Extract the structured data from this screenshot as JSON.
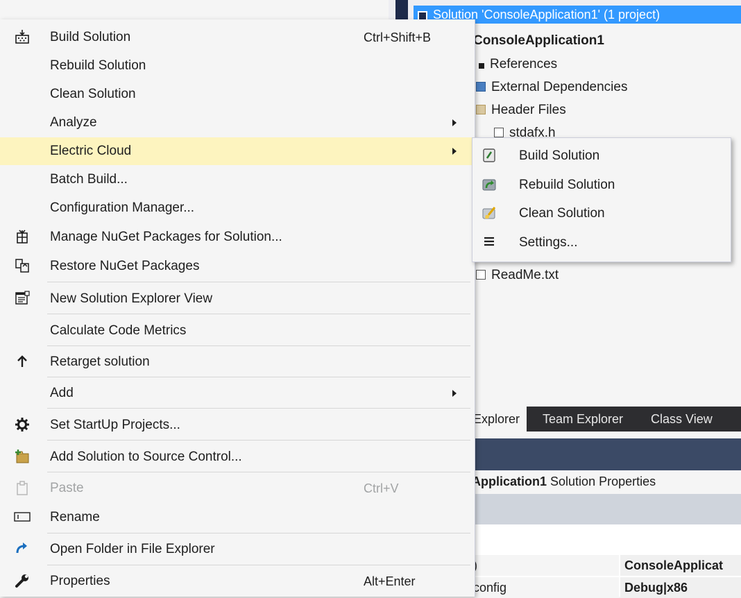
{
  "solution_explorer": {
    "root": "Solution 'ConsoleApplication1' (1 project)",
    "project": "ConsoleApplication1",
    "nodes": [
      "References",
      "External Dependencies",
      "Header Files",
      "stdafx.h",
      "ReadMe.txt"
    ],
    "tabs": [
      "Explorer",
      "Team Explorer",
      "Class View"
    ]
  },
  "properties": {
    "title_bold": "Application1",
    "title_rest": "Solution Properties",
    "rows": [
      {
        "key": ")",
        "value": "ConsoleApplicat"
      },
      {
        "key": "config",
        "value": "Debug|x86"
      }
    ]
  },
  "menu": {
    "items": [
      {
        "label": "Build Solution",
        "shortcut": "Ctrl+Shift+B",
        "icon": "build-icon"
      },
      {
        "label": "Rebuild Solution"
      },
      {
        "label": "Clean Solution"
      },
      {
        "label": "Analyze",
        "submenu": true
      },
      {
        "label": "Electric Cloud",
        "submenu": true,
        "highlighted": true
      },
      {
        "label": "Batch Build..."
      },
      {
        "label": "Configuration Manager..."
      },
      {
        "label": "Manage NuGet Packages for Solution...",
        "icon": "nuget-icon"
      },
      {
        "label": "Restore NuGet Packages",
        "icon": "restore-icon"
      },
      {
        "label": "New Solution Explorer View",
        "icon": "new-view-icon"
      },
      {
        "label": "Calculate Code Metrics"
      },
      {
        "label": "Retarget solution",
        "icon": "arrow-up-icon"
      },
      {
        "label": "Add",
        "submenu": true
      },
      {
        "label": "Set StartUp Projects...",
        "icon": "gear-icon"
      },
      {
        "label": "Add Solution to Source Control...",
        "icon": "source-control-icon"
      },
      {
        "label": "Paste",
        "shortcut": "Ctrl+V",
        "icon": "paste-icon",
        "disabled": true
      },
      {
        "label": "Rename",
        "icon": "rename-icon"
      },
      {
        "label": "Open Folder in File Explorer",
        "icon": "open-folder-icon"
      },
      {
        "label": "Properties",
        "shortcut": "Alt+Enter",
        "icon": "wrench-icon"
      }
    ]
  },
  "submenu": {
    "items": [
      {
        "label": "Build Solution",
        "icon": "ec-build-icon"
      },
      {
        "label": "Rebuild Solution",
        "icon": "ec-rebuild-icon"
      },
      {
        "label": "Clean Solution",
        "icon": "ec-clean-icon"
      },
      {
        "label": "Settings...",
        "icon": "hamburger-icon"
      }
    ]
  },
  "colors": {
    "selection": "#3399ff",
    "highlight": "#fdf4bf",
    "menu_bg": "#f5f5f5",
    "dark_tab_bar": "#2d2d30"
  }
}
